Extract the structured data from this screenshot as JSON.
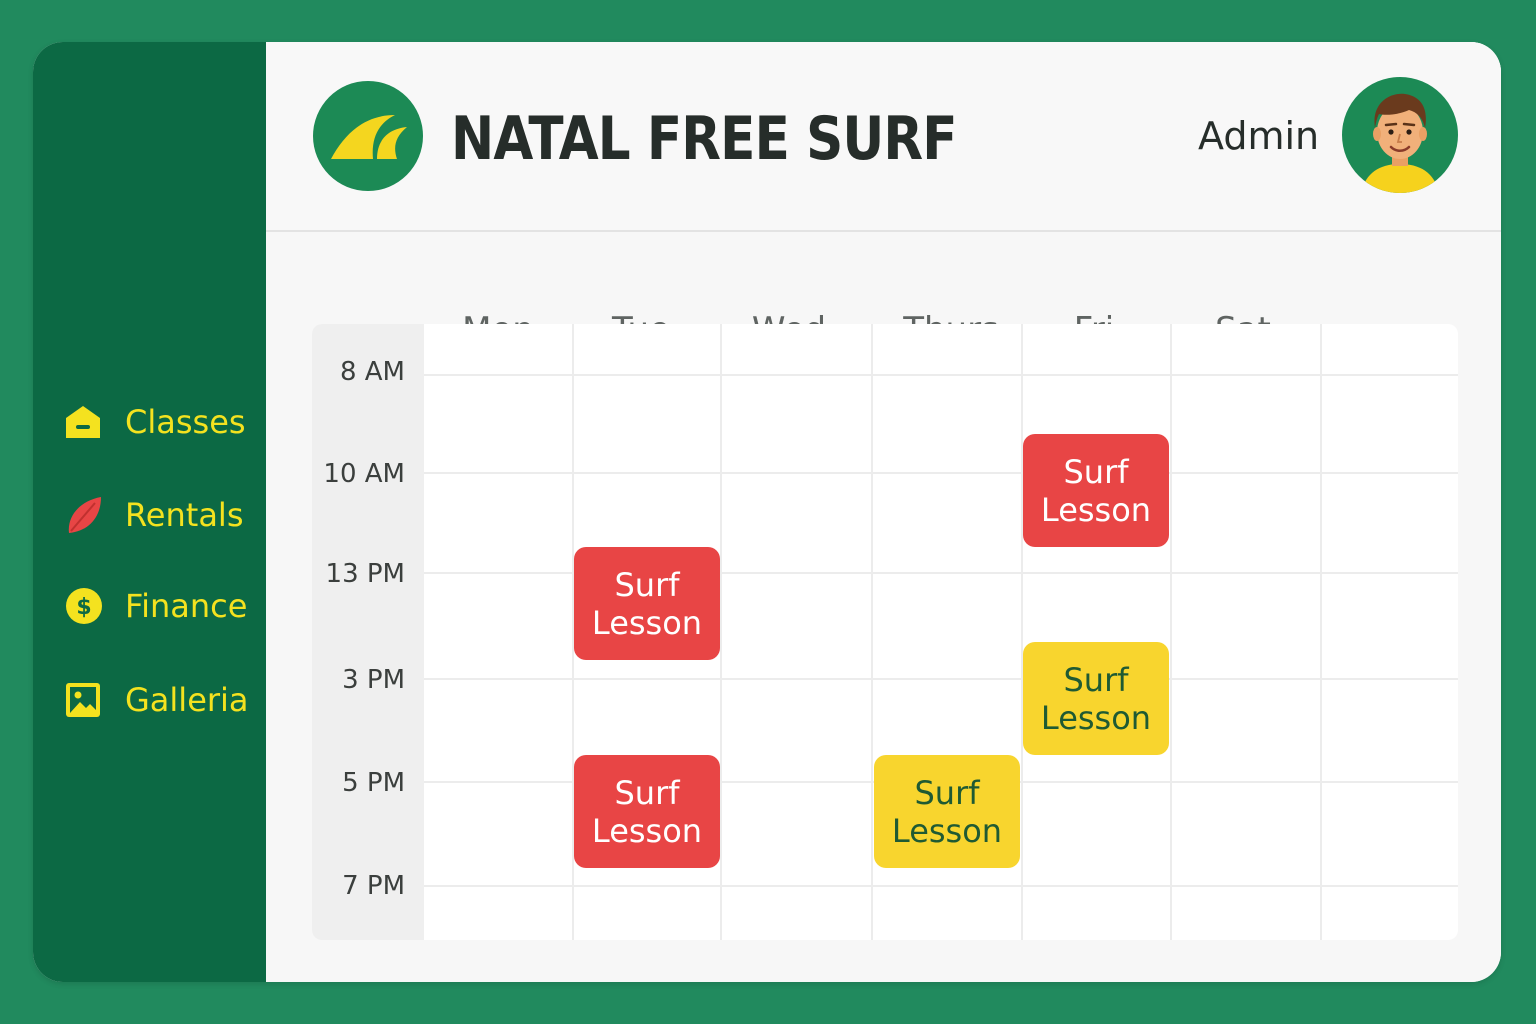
{
  "header": {
    "brand": "NATAL FREE SURF",
    "user_label": "Admin"
  },
  "sidebar": {
    "items": [
      {
        "label": "Classes",
        "icon": "house-icon"
      },
      {
        "label": "Rentals",
        "icon": "leaf-surfboard-icon"
      },
      {
        "label": "Finance",
        "icon": "dollar-coin-icon"
      },
      {
        "label": "Galleria",
        "icon": "image-icon"
      }
    ]
  },
  "calendar": {
    "days": [
      "Mon",
      "Tue",
      "Wed",
      "Thurs",
      "Fri",
      "Sat"
    ],
    "times": [
      "8 AM",
      "10 AM",
      "13 PM",
      "3 PM",
      "5 PM",
      "7 PM"
    ],
    "events": [
      {
        "day": "Tue",
        "time": "13 PM",
        "line1": "Surf",
        "line2": "Lesson",
        "color": "red"
      },
      {
        "day": "Tue",
        "time": "5 PM",
        "line1": "Surf",
        "line2": "Lesson",
        "color": "red"
      },
      {
        "day": "Thurs",
        "time": "5 PM",
        "line1": "Surf",
        "line2": "Lesson",
        "color": "yellow"
      },
      {
        "day": "Fri",
        "time": "10 AM",
        "line1": "Surf",
        "line2": "Lesson",
        "color": "red"
      },
      {
        "day": "Fri",
        "time": "3 PM",
        "line1": "Surf",
        "line2": "Lesson",
        "color": "yellow"
      }
    ]
  },
  "colors": {
    "background": "#218a5e",
    "sidebar": "#0c6944",
    "nav_text": "#f4e21f",
    "event_red": "#e84545",
    "event_yellow": "#f8d52e",
    "event_yellow_text": "#1f5a33"
  }
}
